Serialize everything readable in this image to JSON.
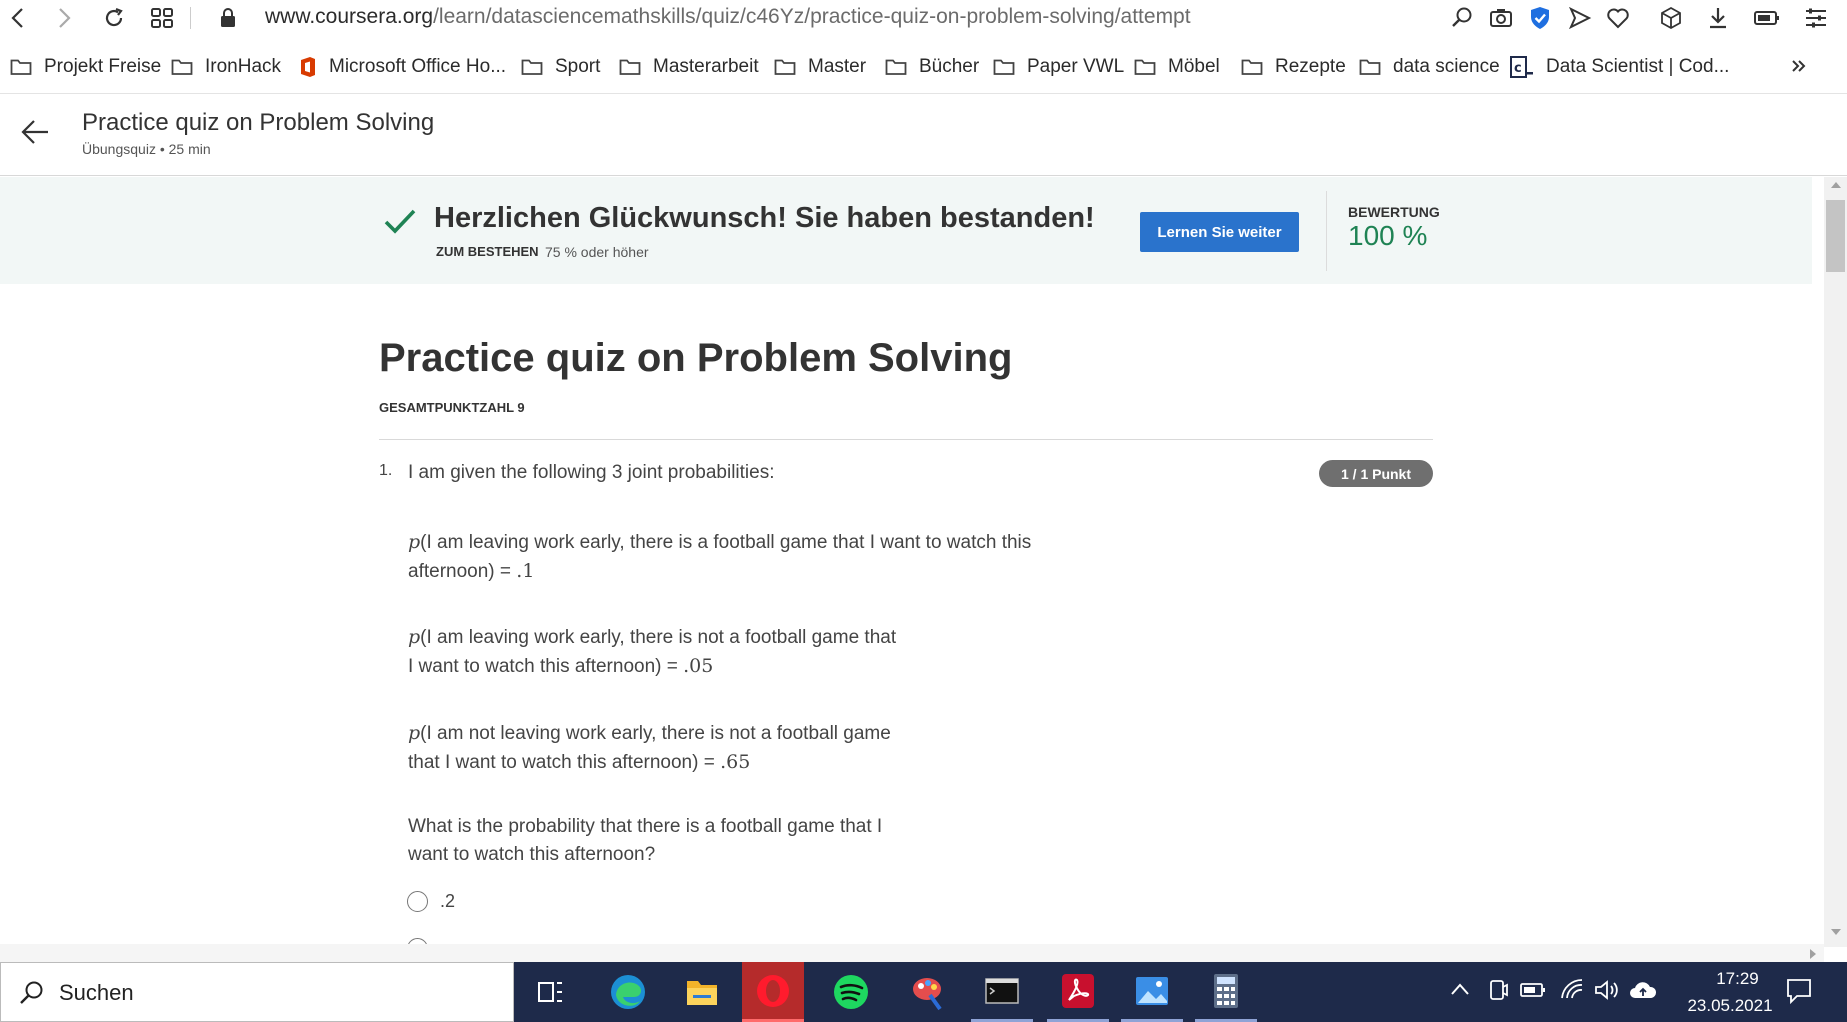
{
  "browser": {
    "url_host": "www.coursera.org",
    "url_path": "/learn/datasciencemathskills/quiz/c46Yz/practice-quiz-on-problem-solving/attempt"
  },
  "bookmarks": [
    {
      "label": "Projekt Freise",
      "icon": "folder-icon"
    },
    {
      "label": "IronHack",
      "icon": "folder-icon"
    },
    {
      "label": "Microsoft Office Ho...",
      "icon": "office-icon"
    },
    {
      "label": "Sport",
      "icon": "folder-icon"
    },
    {
      "label": "Masterarbeit",
      "icon": "folder-icon"
    },
    {
      "label": "Master",
      "icon": "folder-icon"
    },
    {
      "label": "Bücher",
      "icon": "folder-icon"
    },
    {
      "label": "Paper VWL",
      "icon": "folder-icon"
    },
    {
      "label": "Möbel",
      "icon": "folder-icon"
    },
    {
      "label": "Rezepte",
      "icon": "folder-icon"
    },
    {
      "label": "data science",
      "icon": "folder-icon"
    },
    {
      "label": "Data Scientist | Cod...",
      "icon": "codecademy-icon"
    }
  ],
  "header": {
    "title": "Practice quiz on Problem Solving",
    "subtitle": "Übungsquiz • 25 min"
  },
  "banner": {
    "title": "Herzlichen Glückwunsch! Sie haben bestanden!",
    "pass_label": "ZUM BESTEHEN",
    "pass_value": "75 % oder höher",
    "button": "Lernen Sie weiter",
    "grade_label": "BEWERTUNG",
    "grade_value": "100 %",
    "accent": "#1f8354",
    "button_color": "#2a73cc"
  },
  "quiz": {
    "title": "Practice quiz on Problem Solving",
    "total_points": "GESAMTPUNKTZAHL 9",
    "question": {
      "number": "1.",
      "intro": "I am given the following 3 joint probabilities:",
      "badge": "1 / 1 Punkt",
      "probabilities": [
        {
          "prefix": "p",
          "line1": "(I am leaving work early, there is a football game that I want to watch this",
          "line2": "afternoon) = ",
          "value": ".1"
        },
        {
          "prefix": "p",
          "line1": "(I am leaving work early, there is not a football game that",
          "line2": "I want to watch this afternoon) = ",
          "value": ".05"
        },
        {
          "prefix": "p",
          "line1": "(I am not leaving work early, there is not a football game",
          "line2": "that I want to watch this afternoon) = ",
          "value": ".65"
        }
      ],
      "ask_line1": "What is the probability that there is a football game that I",
      "ask_line2": "want to watch this afternoon?",
      "options": [
        ".2"
      ]
    }
  },
  "taskbar": {
    "search_placeholder": "Suchen",
    "time": "17:29",
    "date": "23.05.2021",
    "apps": [
      "task-view-icon",
      "edge-icon",
      "file-explorer-icon",
      "opera-icon",
      "spotify-icon",
      "paint-icon",
      "terminal-icon",
      "acrobat-icon",
      "photos-icon",
      "calculator-icon"
    ]
  }
}
